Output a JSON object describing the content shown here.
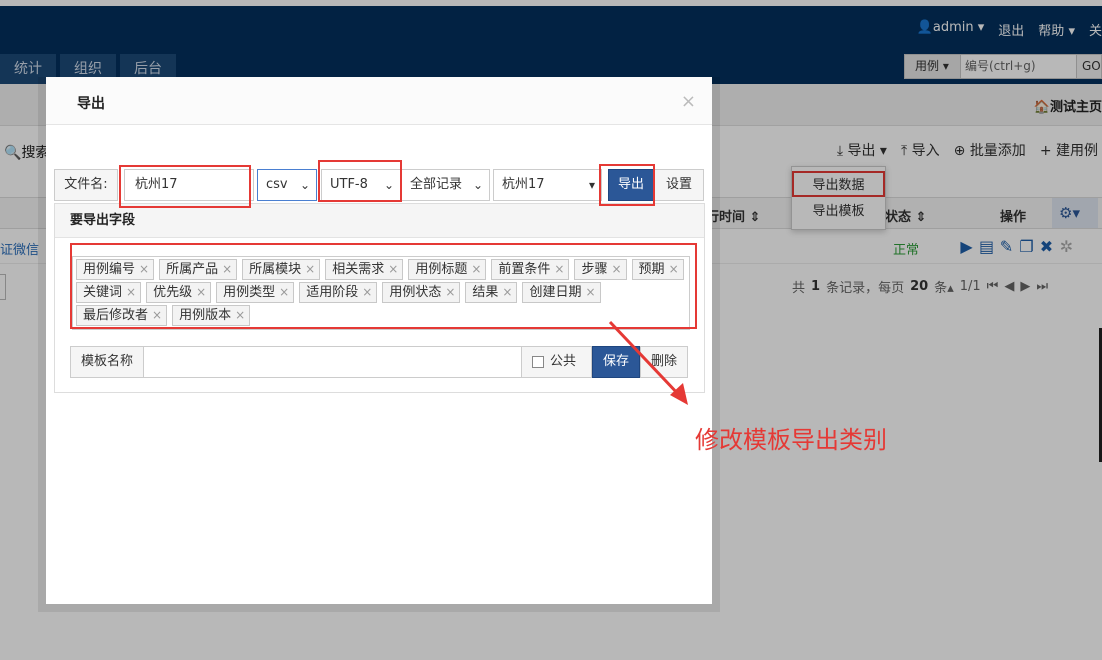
{
  "topnav": {
    "user": "admin",
    "logout": "退出",
    "help": "帮助",
    "more": "关",
    "tabs": [
      "统计",
      "组织",
      "后台"
    ],
    "search": {
      "type": "用例",
      "placeholder": "编号(ctrl+g)",
      "go": "GO"
    }
  },
  "page": {
    "home_link": "测试主页",
    "search_label": "搜索",
    "actions": [
      "导出",
      "导入",
      "批量添加",
      "建用例"
    ],
    "export_menu": [
      "导出数据",
      "导出模板"
    ],
    "table_headers": {
      "exec_time": "行时间",
      "status": "状态",
      "ops": "操作"
    },
    "row": {
      "title_fragment": "证微信",
      "status": "正常"
    },
    "pager": {
      "prefix": "共",
      "count": "1",
      "mid": "条记录，每页",
      "per_page": "20",
      "suffix": "条",
      "pages": "1/1"
    }
  },
  "modal": {
    "title": "导出",
    "file_label": "文件名:",
    "file_value": "杭州17",
    "format": "csv",
    "encoding": "UTF-8",
    "range": "全部记录",
    "template": "杭州17",
    "export_button": "导出",
    "settings_button": "设置",
    "fields_title": "要导出字段",
    "fields": [
      "用例编号",
      "所属产品",
      "所属模块",
      "相关需求",
      "用例标题",
      "前置条件",
      "步骤",
      "预期",
      "关键词",
      "优先级",
      "用例类型",
      "适用阶段",
      "用例状态",
      "结果",
      "创建日期",
      "最后修改者",
      "用例版本"
    ],
    "template_label": "模板名称",
    "public_label": "公共",
    "save_button": "保存",
    "delete_button": "删除"
  },
  "annotation": {
    "text": "修改模板导出类别",
    "color": "#e53935"
  },
  "colors": {
    "nav": "#03305e",
    "primary": "#2b5797",
    "highlight": "#e53935"
  }
}
